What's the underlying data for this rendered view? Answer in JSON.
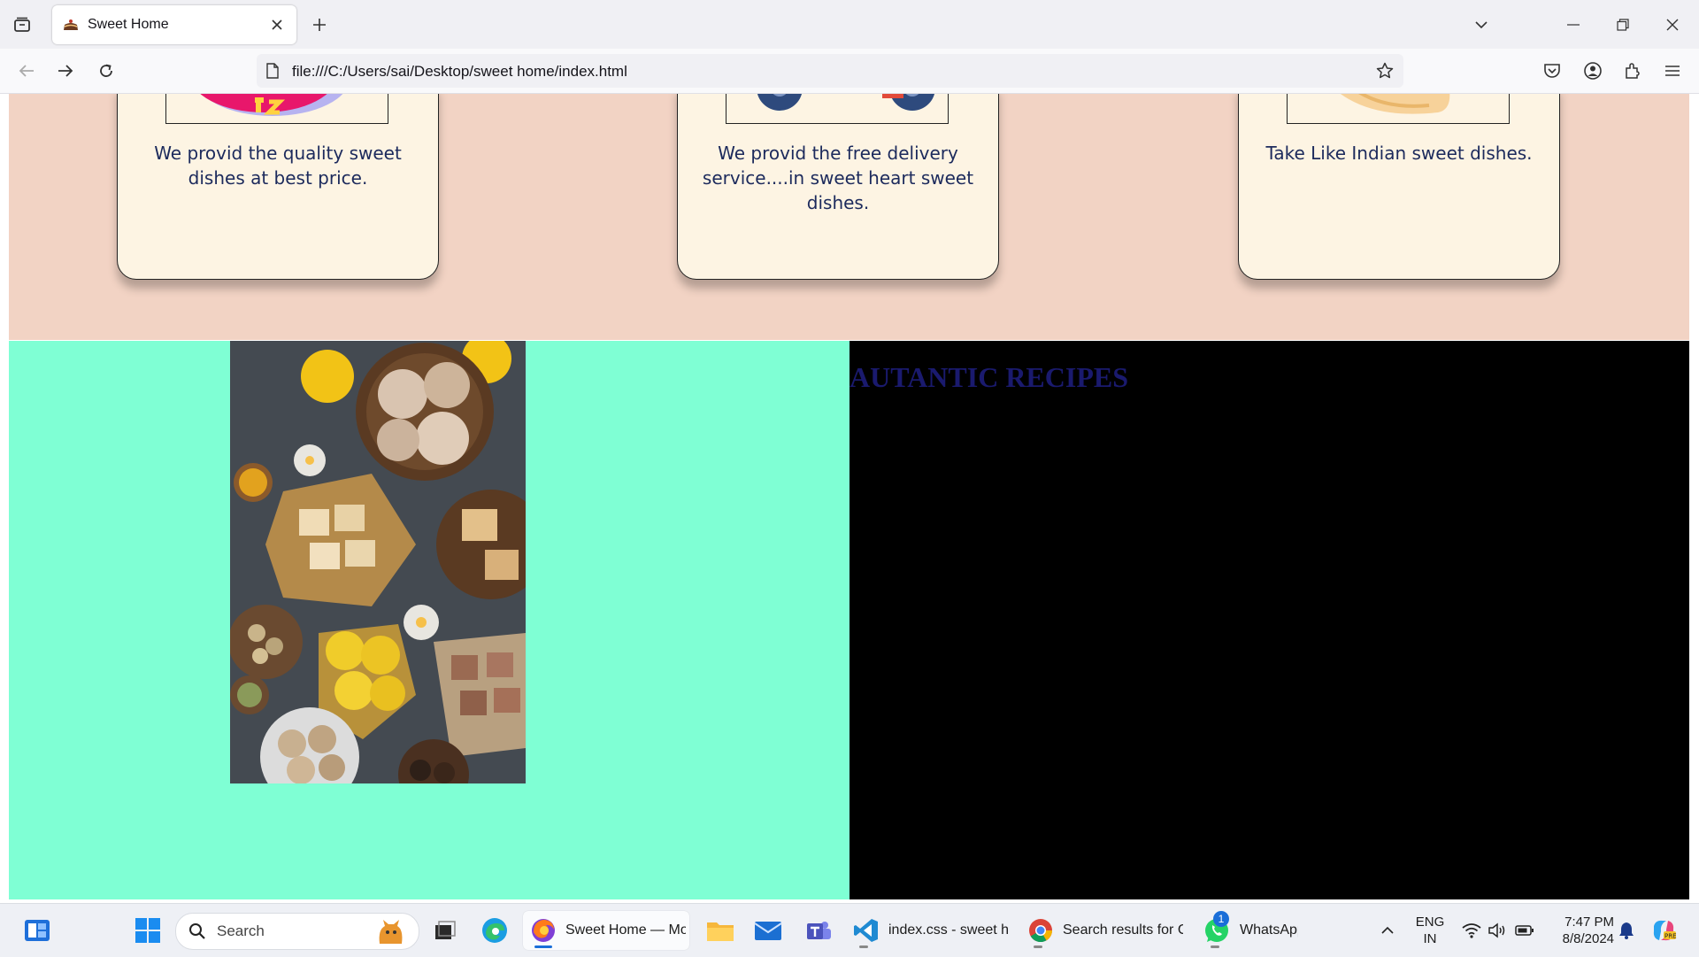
{
  "browser": {
    "tab_title": "Sweet Home",
    "url": "file:///C:/Users/sai/Desktop/sweet home/index.html"
  },
  "page": {
    "cards": [
      {
        "text": "We provid the quality sweet dishes at best price."
      },
      {
        "text": "We provid the free delivery service....in sweet heart sweet dishes."
      },
      {
        "text": "Take Like Indian sweet dishes."
      }
    ],
    "recipes_title": "AUTANTIC RECIPES",
    "colors": {
      "pink_section": "#f2d3c4",
      "card_bg": "#fdf4e3",
      "green_section": "#7fffd4",
      "black_section": "#000000",
      "title_color": "#1a1a6e"
    }
  },
  "taskbar": {
    "search_placeholder": "Search",
    "apps": [
      {
        "label": "Sweet Home — Mo:",
        "icon": "firefox-icon"
      },
      {
        "label": "index.css - sweet ho",
        "icon": "vscode-icon"
      },
      {
        "label": "Search results for Cc",
        "icon": "chrome-icon"
      },
      {
        "label": "WhatsApp",
        "icon": "whatsapp-icon",
        "badge": "1"
      }
    ],
    "language": "ENG",
    "region": "IN",
    "time": "7:47 PM",
    "date": "8/8/2024"
  }
}
